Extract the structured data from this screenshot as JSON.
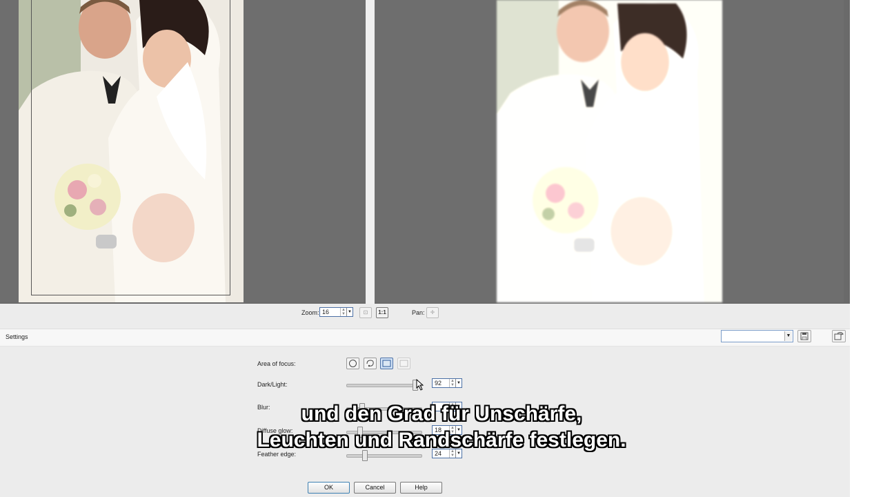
{
  "zoom": {
    "label": "Zoom:",
    "value": "16"
  },
  "pan": {
    "label": "Pan:"
  },
  "settings": {
    "label": "Settings",
    "preset_value": ""
  },
  "controls": {
    "area_of_focus": {
      "label": "Area of focus:"
    },
    "dark_light": {
      "label": "Dark/Light:",
      "value": "92",
      "level": 0.92
    },
    "blur": {
      "label": "Blur:",
      "value": "",
      "level": 0.2
    },
    "diffuse_glow": {
      "label": "Diffuse glow:",
      "value": "18",
      "level": 0.18
    },
    "feather_edge": {
      "label": "Feather edge:",
      "value": "24",
      "level": 0.24
    }
  },
  "buttons": {
    "ok": "OK",
    "cancel": "Cancel",
    "help": "Help"
  },
  "subtitle": {
    "line1": "und den Grad für Unschärfe,",
    "line2": "Leuchten und Randschärfe festlegen."
  },
  "colors": {
    "accent": "#4a6fa5",
    "preview_bg": "#6e6e6e"
  }
}
